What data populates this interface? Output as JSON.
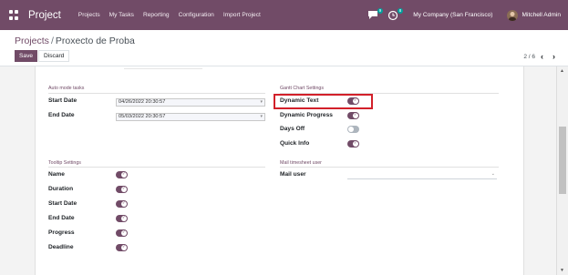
{
  "navbar": {
    "brand": "Project",
    "links": [
      "Projects",
      "My Tasks",
      "Reporting",
      "Configuration",
      "Import Project"
    ],
    "messages_badge": "9",
    "activity_badge": "8",
    "company": "My Company (San Francisco)",
    "user": "Mitchell Admin"
  },
  "breadcrumb": {
    "parent": "Projects",
    "separator": "/",
    "current": "Proxecto de Proba"
  },
  "actions": {
    "save_label": "Save",
    "discard_label": "Discard"
  },
  "pager": {
    "value": "2 / 6",
    "prev": "‹",
    "next": "›"
  },
  "auto_mode": {
    "title": "Auto mode tasks",
    "start_date_label": "Start Date",
    "start_date_value": "04/26/2022 20:30:57",
    "end_date_label": "End Date",
    "end_date_value": "05/03/2022 20:30:57"
  },
  "gantt": {
    "title": "Gantt Chart Settings",
    "items": [
      {
        "label": "Dynamic Text",
        "on": true
      },
      {
        "label": "Dynamic Progress",
        "on": true
      },
      {
        "label": "Days Off",
        "on": false
      },
      {
        "label": "Quick Info",
        "on": true
      }
    ]
  },
  "tooltip": {
    "title": "Tooltip Settings",
    "items": [
      {
        "label": "Name",
        "on": true
      },
      {
        "label": "Duration",
        "on": true
      },
      {
        "label": "Start Date",
        "on": true
      },
      {
        "label": "End Date",
        "on": true
      },
      {
        "label": "Progress",
        "on": true
      },
      {
        "label": "Deadline",
        "on": true
      }
    ]
  },
  "mail_timesheet": {
    "title": "Mail timesheet user",
    "mail_user_label": "Mail user",
    "mail_user_value": ""
  },
  "colors": {
    "brand": "#714b67",
    "highlight": "#d2202a",
    "toggle_off": "#adb5bd"
  }
}
